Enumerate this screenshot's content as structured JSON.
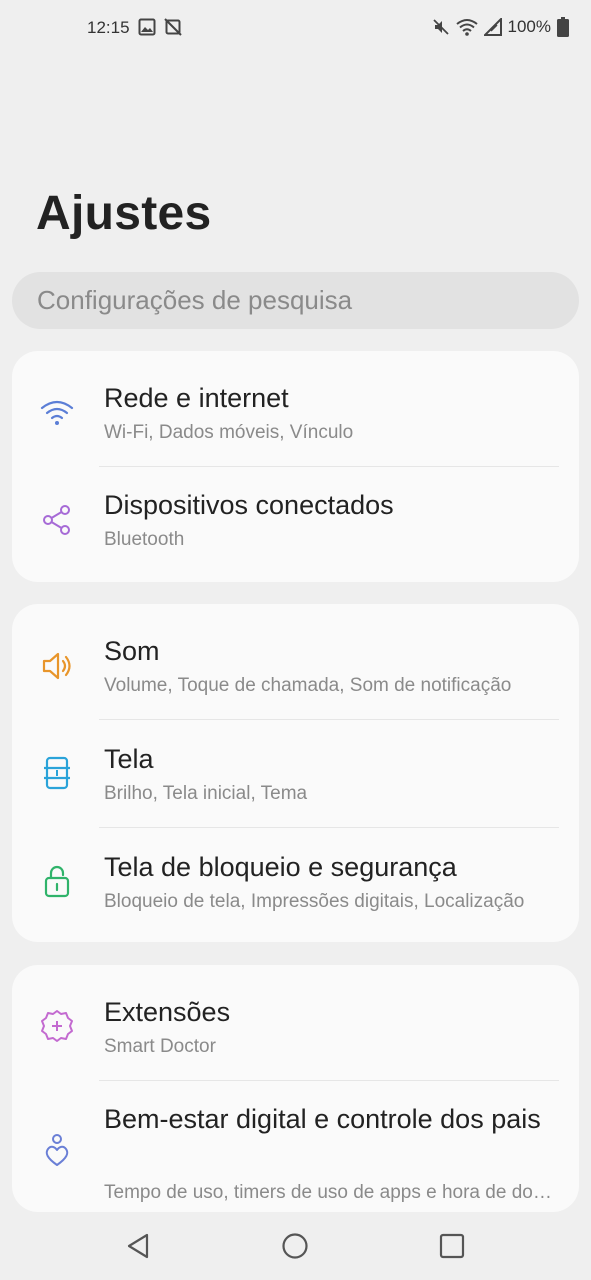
{
  "status_bar": {
    "time": "12:15",
    "battery": "100%",
    "icons": [
      "image-icon",
      "no-sync-icon",
      "mute-icon",
      "wifi-icon",
      "signal-icon",
      "battery-icon"
    ]
  },
  "title": "Ajustes",
  "search": {
    "placeholder": "Configurações de pesquisa"
  },
  "groups": [
    {
      "items": [
        {
          "icon": "wifi-icon",
          "title": "Rede e internet",
          "subtitle": "Wi-Fi, Dados móveis, Vínculo",
          "color": "#5b7ed6"
        },
        {
          "icon": "share-icon",
          "title": "Dispositivos conectados",
          "subtitle": "Bluetooth",
          "color": "#a66ad6"
        }
      ]
    },
    {
      "items": [
        {
          "icon": "speaker-icon",
          "title": "Som",
          "subtitle": "Volume, Toque de chamada, Som de notificação",
          "color": "#e8952a"
        },
        {
          "icon": "display-icon",
          "title": "Tela",
          "subtitle": "Brilho, Tela inicial, Tema",
          "color": "#2aa3d9"
        },
        {
          "icon": "lock-icon",
          "title": "Tela de bloqueio e segurança",
          "subtitle": "Bloqueio de tela, Impressões digitais, Localização",
          "color": "#2fb36a"
        }
      ]
    },
    {
      "items": [
        {
          "icon": "extension-gear-icon",
          "title": "Extensões",
          "subtitle": "Smart Doctor",
          "color": "#c36ad0"
        },
        {
          "icon": "wellbeing-icon",
          "title": "Bem-estar digital e controle dos pais",
          "subtitle": "Tempo de uso, timers de uso de apps e hora de dormir",
          "color": "#6a7fd6"
        }
      ]
    }
  ],
  "nav": {
    "buttons": [
      "back-icon",
      "home-icon",
      "recents-icon"
    ]
  }
}
